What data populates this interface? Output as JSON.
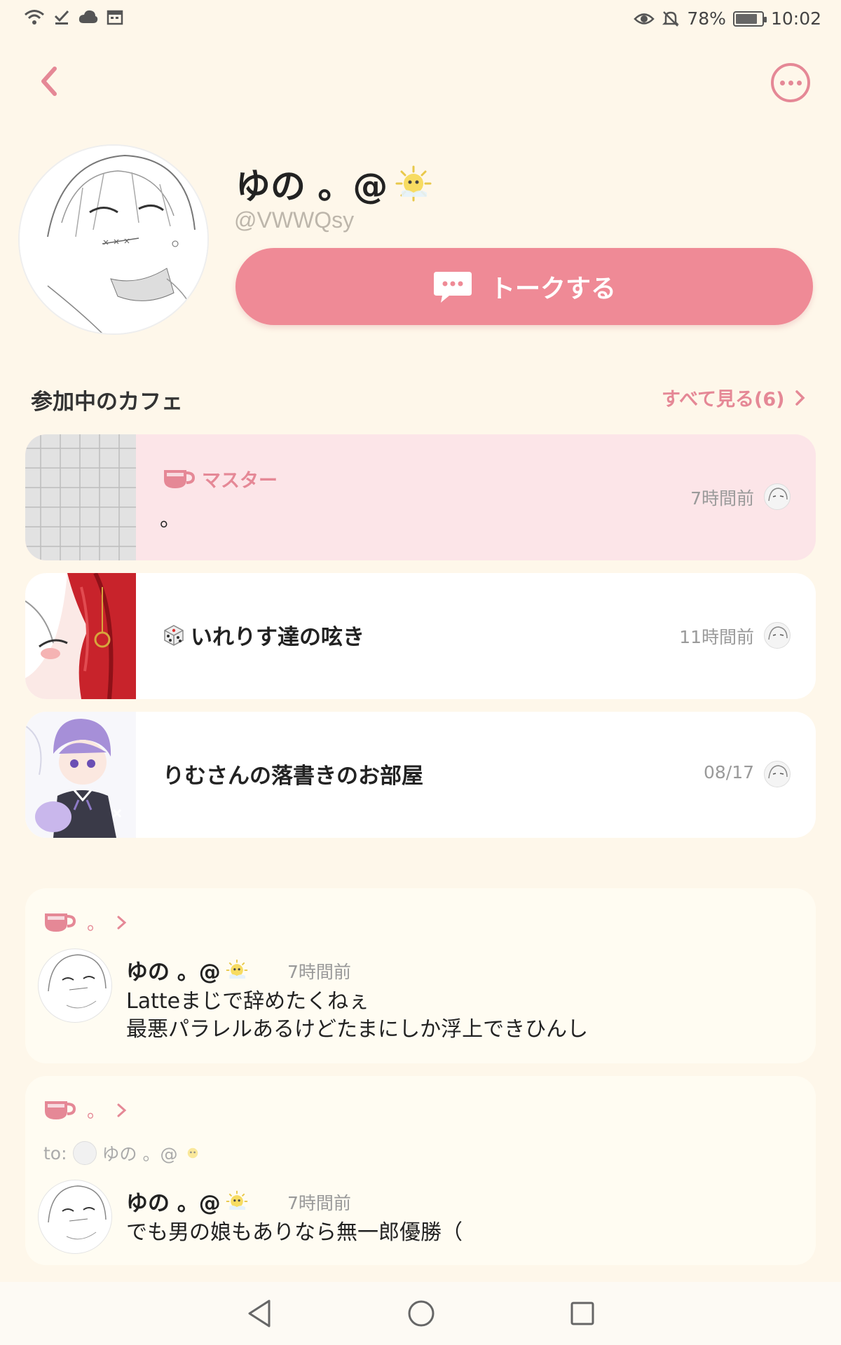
{
  "status_bar": {
    "battery_percent": "78%",
    "time": "10:02"
  },
  "profile": {
    "name": "ゆの 。@",
    "handle": "@VWWQsy",
    "talk_button_label": "トークする"
  },
  "cafes_section": {
    "title": "参加中のカフェ",
    "see_all_label": "すべて見る(6)",
    "items": [
      {
        "role_label": "マスター",
        "name": "。",
        "time": "7時間前"
      },
      {
        "name": "いれりす達の呟き",
        "time": "11時間前"
      },
      {
        "name": "りむさんの落書きのお部屋",
        "time": "08/17"
      }
    ]
  },
  "posts": [
    {
      "cafe": "。",
      "author": "ゆの 。@",
      "time": "7時間前",
      "text": "Latteまじで辞めたくねぇ\n最悪パラレルあるけどたまにしか浮上できひんし"
    },
    {
      "cafe": "。",
      "to_label": "to:",
      "to_user": "ゆの 。@",
      "author": "ゆの 。@",
      "time": "7時間前",
      "text": "でも男の娘もありなら無一郎優勝（"
    }
  ],
  "colors": {
    "background": "#FEF7EA",
    "accent": "#EF8A96",
    "accent_text": "#E58896",
    "active_card": "#FCE5E8"
  }
}
